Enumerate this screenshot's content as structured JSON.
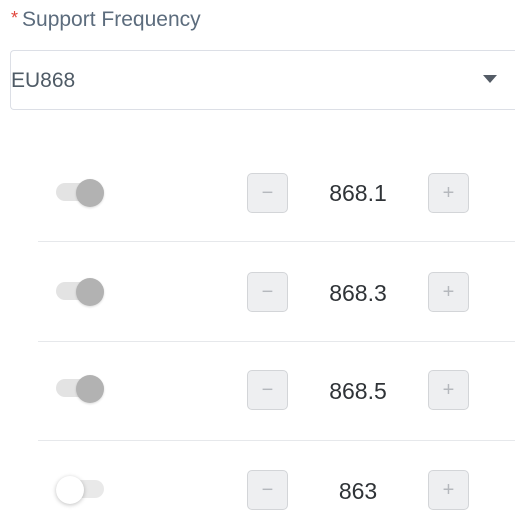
{
  "field": {
    "required_mark": "*",
    "label": "Support Frequency"
  },
  "select": {
    "value": "EU868",
    "icon": "caret-down-icon"
  },
  "channels": [
    {
      "enabled": true,
      "frequency": "868.1",
      "minus": "−",
      "plus": "+"
    },
    {
      "enabled": true,
      "frequency": "868.3",
      "minus": "−",
      "plus": "+"
    },
    {
      "enabled": true,
      "frequency": "868.5",
      "minus": "−",
      "plus": "+"
    },
    {
      "enabled": false,
      "frequency": "863",
      "minus": "−",
      "plus": "+"
    }
  ],
  "colors": {
    "required": "#e0463c",
    "label": "#5c6c7d",
    "toggle_on_knob": "#b2b2b2",
    "toggle_track": "#e3e3e3",
    "stepper_bg": "#eeeff1"
  }
}
